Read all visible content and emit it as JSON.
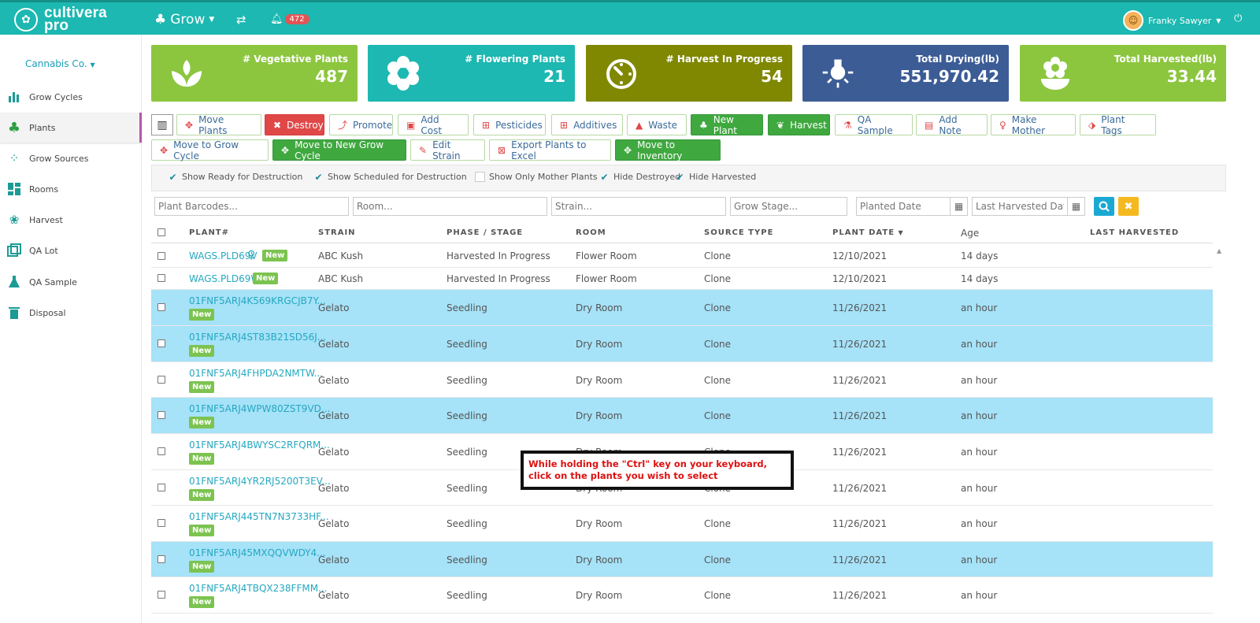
{
  "header": {
    "brand_line1": "cultivera",
    "brand_line2": "pro",
    "module": "Grow",
    "notification_count": "472",
    "user_name": "Franky Sawyer"
  },
  "sidebar": {
    "company": "Cannabis Co.",
    "items": [
      {
        "label": "Grow Cycles",
        "icon": "bar-chart-icon"
      },
      {
        "label": "Plants",
        "icon": "tree-icon"
      },
      {
        "label": "Grow Sources",
        "icon": "seeds-icon"
      },
      {
        "label": "Rooms",
        "icon": "grid-icon"
      },
      {
        "label": "Harvest",
        "icon": "harvest-icon"
      },
      {
        "label": "QA Lot",
        "icon": "layers-icon"
      },
      {
        "label": "QA Sample",
        "icon": "flask-icon"
      },
      {
        "label": "Disposal",
        "icon": "trash-icon"
      }
    ]
  },
  "kpis": [
    {
      "label": "# Vegetative Plants",
      "value": "487",
      "color": "#8cc63f"
    },
    {
      "label": "# Flowering Plants",
      "value": "21",
      "color": "#1cb8b1"
    },
    {
      "label": "# Harvest In Progress",
      "value": "54",
      "color": "#7f8800"
    },
    {
      "label": "Total Drying(lb)",
      "value": "551,970.42",
      "color": "#3c5c96"
    },
    {
      "label": "Total Harvested(lb)",
      "value": "33.44",
      "color": "#8cc63f"
    }
  ],
  "toolbar": {
    "row1": [
      "Move Plants",
      "Destroy",
      "Promote",
      "Add Cost",
      "Pesticides",
      "Additives",
      "Waste",
      "New Plant",
      "Harvest",
      "QA Sample",
      "Add Note",
      "Make Mother",
      "Plant Tags"
    ],
    "row2": [
      "Move to Grow Cycle",
      "Move to New Grow Cycle",
      "Edit Strain",
      "Export Plants to Excel",
      "Move to Inventory"
    ]
  },
  "filters": {
    "checks": [
      {
        "label": "Show Ready for Destruction",
        "checked": true
      },
      {
        "label": "Show Scheduled for Destruction",
        "checked": true
      },
      {
        "label": "Show Only Mother Plants",
        "checked": false
      },
      {
        "label": "Hide Destroyed",
        "checked": true
      },
      {
        "label": "Hide Harvested",
        "checked": true
      }
    ],
    "placeholders": {
      "barcodes": "Plant Barcodes...",
      "room": "Room...",
      "strain": "Strain...",
      "stage": "Grow Stage...",
      "planted": "Planted Date",
      "harvested": "Last Harvested Date"
    }
  },
  "table": {
    "headers": [
      "PLANT#",
      "STRAIN",
      "PHASE / STAGE",
      "ROOM",
      "SOURCE TYPE",
      "PLANT DATE",
      "Age",
      "LAST HARVESTED"
    ],
    "badge": "New",
    "rows": [
      {
        "plant": "WAGS.PLD69V",
        "strain": "ABC Kush",
        "stage": "Harvested In Progress",
        "room": "Flower Room",
        "source": "Clone",
        "date": "12/10/2021",
        "age": "14 days",
        "selected": false
      },
      {
        "plant": "WAGS.PLD69W",
        "strain": "ABC Kush",
        "stage": "Harvested In Progress",
        "room": "Flower Room",
        "source": "Clone",
        "date": "12/10/2021",
        "age": "14 days",
        "selected": false
      },
      {
        "plant": "01FNF5ARJ4K569KRGCJB7Y...",
        "strain": "Gelato",
        "stage": "Seedling",
        "room": "Dry Room",
        "source": "Clone",
        "date": "11/26/2021",
        "age": "an hour",
        "selected": true
      },
      {
        "plant": "01FNF5ARJ4ST83B21SD56J...",
        "strain": "Gelato",
        "stage": "Seedling",
        "room": "Dry Room",
        "source": "Clone",
        "date": "11/26/2021",
        "age": "an hour",
        "selected": true
      },
      {
        "plant": "01FNF5ARJ4FHPDA2NMTW...",
        "strain": "Gelato",
        "stage": "Seedling",
        "room": "Dry Room",
        "source": "Clone",
        "date": "11/26/2021",
        "age": "an hour",
        "selected": false
      },
      {
        "plant": "01FNF5ARJ4WPW80ZST9VD...",
        "strain": "Gelato",
        "stage": "Seedling",
        "room": "Dry Room",
        "source": "Clone",
        "date": "11/26/2021",
        "age": "an hour",
        "selected": true
      },
      {
        "plant": "01FNF5ARJ4BWYSC2RFQRM...",
        "strain": "Gelato",
        "stage": "Seedling",
        "room": "Dry Room",
        "source": "Clone",
        "date": "11/26/2021",
        "age": "an hour",
        "selected": false
      },
      {
        "plant": "01FNF5ARJ4YR2RJ5200T3EV...",
        "strain": "Gelato",
        "stage": "Seedling",
        "room": "Dry Room",
        "source": "Clone",
        "date": "11/26/2021",
        "age": "an hour",
        "selected": false
      },
      {
        "plant": "01FNF5ARJ445TN7N3733HF...",
        "strain": "Gelato",
        "stage": "Seedling",
        "room": "Dry Room",
        "source": "Clone",
        "date": "11/26/2021",
        "age": "an hour",
        "selected": false
      },
      {
        "plant": "01FNF5ARJ45MXQQVWDY4...",
        "strain": "Gelato",
        "stage": "Seedling",
        "room": "Dry Room",
        "source": "Clone",
        "date": "11/26/2021",
        "age": "an hour",
        "selected": true
      },
      {
        "plant": "01FNF5ARJ4TBQX238FFMM...",
        "strain": "Gelato",
        "stage": "Seedling",
        "room": "Dry Room",
        "source": "Clone",
        "date": "11/26/2021",
        "age": "an hour",
        "selected": false
      }
    ]
  },
  "callout": "While holding the \"Ctrl\" key on your keyboard, click on the plants you wish to select"
}
